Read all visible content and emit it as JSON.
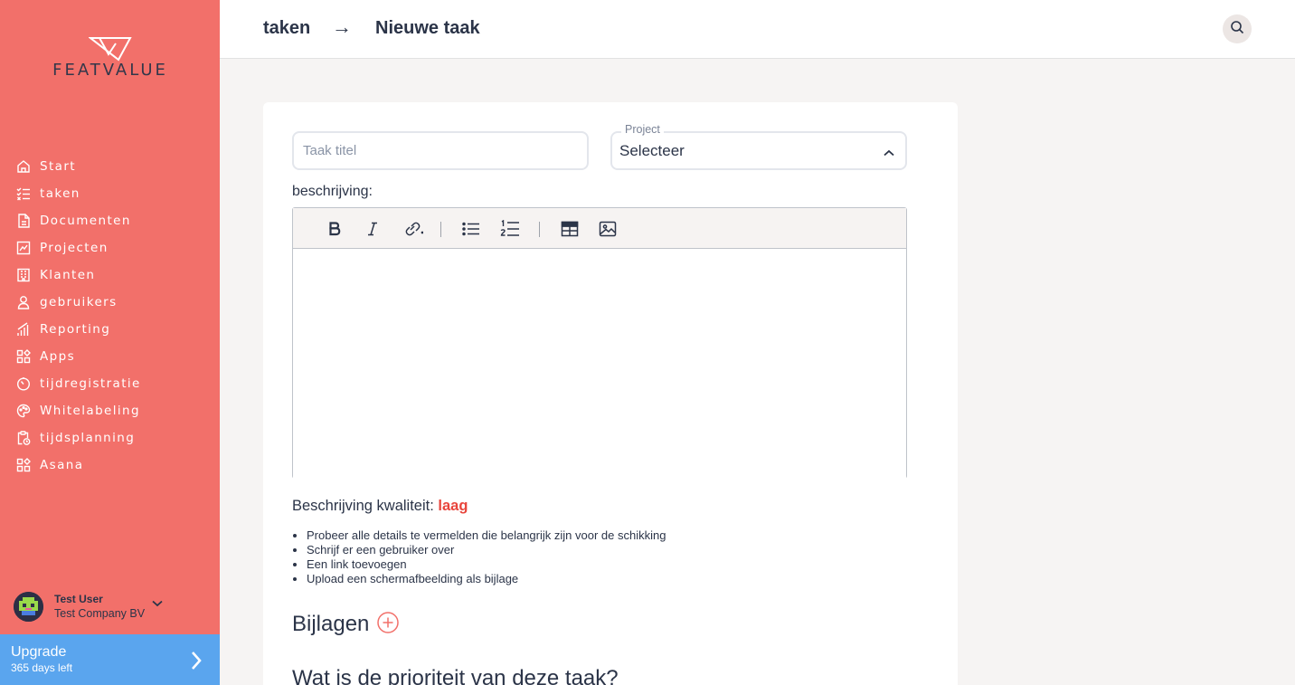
{
  "brand": {
    "name": "FEATVALUE",
    "accent": "#f2706a",
    "upgrade_color": "#5aa5ee"
  },
  "sidebar": {
    "items": [
      {
        "label": "Start",
        "icon": "home-icon"
      },
      {
        "label": "taken",
        "icon": "checklist-icon"
      },
      {
        "label": "Documenten",
        "icon": "document-icon"
      },
      {
        "label": "Projecten",
        "icon": "chart-icon"
      },
      {
        "label": "Klanten",
        "icon": "building-icon"
      },
      {
        "label": "gebruikers",
        "icon": "user-icon"
      },
      {
        "label": "Reporting",
        "icon": "bar-chart-icon"
      },
      {
        "label": "Apps",
        "icon": "apps-icon"
      },
      {
        "label": "tijdregistratie",
        "icon": "timer-icon"
      },
      {
        "label": "Whitelabeling",
        "icon": "palette-icon"
      },
      {
        "label": "tijdsplanning",
        "icon": "clipboard-clock-icon"
      },
      {
        "label": "Asana",
        "icon": "apps-icon"
      }
    ],
    "user": {
      "name": "Test User",
      "company": "Test Company BV"
    },
    "upgrade": {
      "title": "Upgrade",
      "subtitle": "365 days left"
    }
  },
  "header": {
    "breadcrumb": [
      "taken",
      "Nieuwe taak"
    ],
    "separator": "→"
  },
  "form": {
    "title_placeholder": "Taak titel",
    "title_value": "",
    "project_label": "Project",
    "project_value": "Selecteer",
    "description_label": "beschrijving:",
    "toolbar_buttons": [
      "bold-icon",
      "italic-icon",
      "link-icon",
      "bullet-list-icon",
      "numbered-list-icon",
      "table-icon",
      "image-icon"
    ],
    "quality_label": "Beschrijving kwaliteit:",
    "quality_value": "laag",
    "quality_color": "#e8453c",
    "tips": [
      "Probeer alle details te vermelden die belangrijk zijn voor de schikking",
      "Schrijf er een gebruiker over",
      "Een link toevoegen",
      "Upload een schermafbeelding als bijlage"
    ],
    "attachments_title": "Bijlagen",
    "priority_title": "Wat is de prioriteit van deze taak?"
  }
}
